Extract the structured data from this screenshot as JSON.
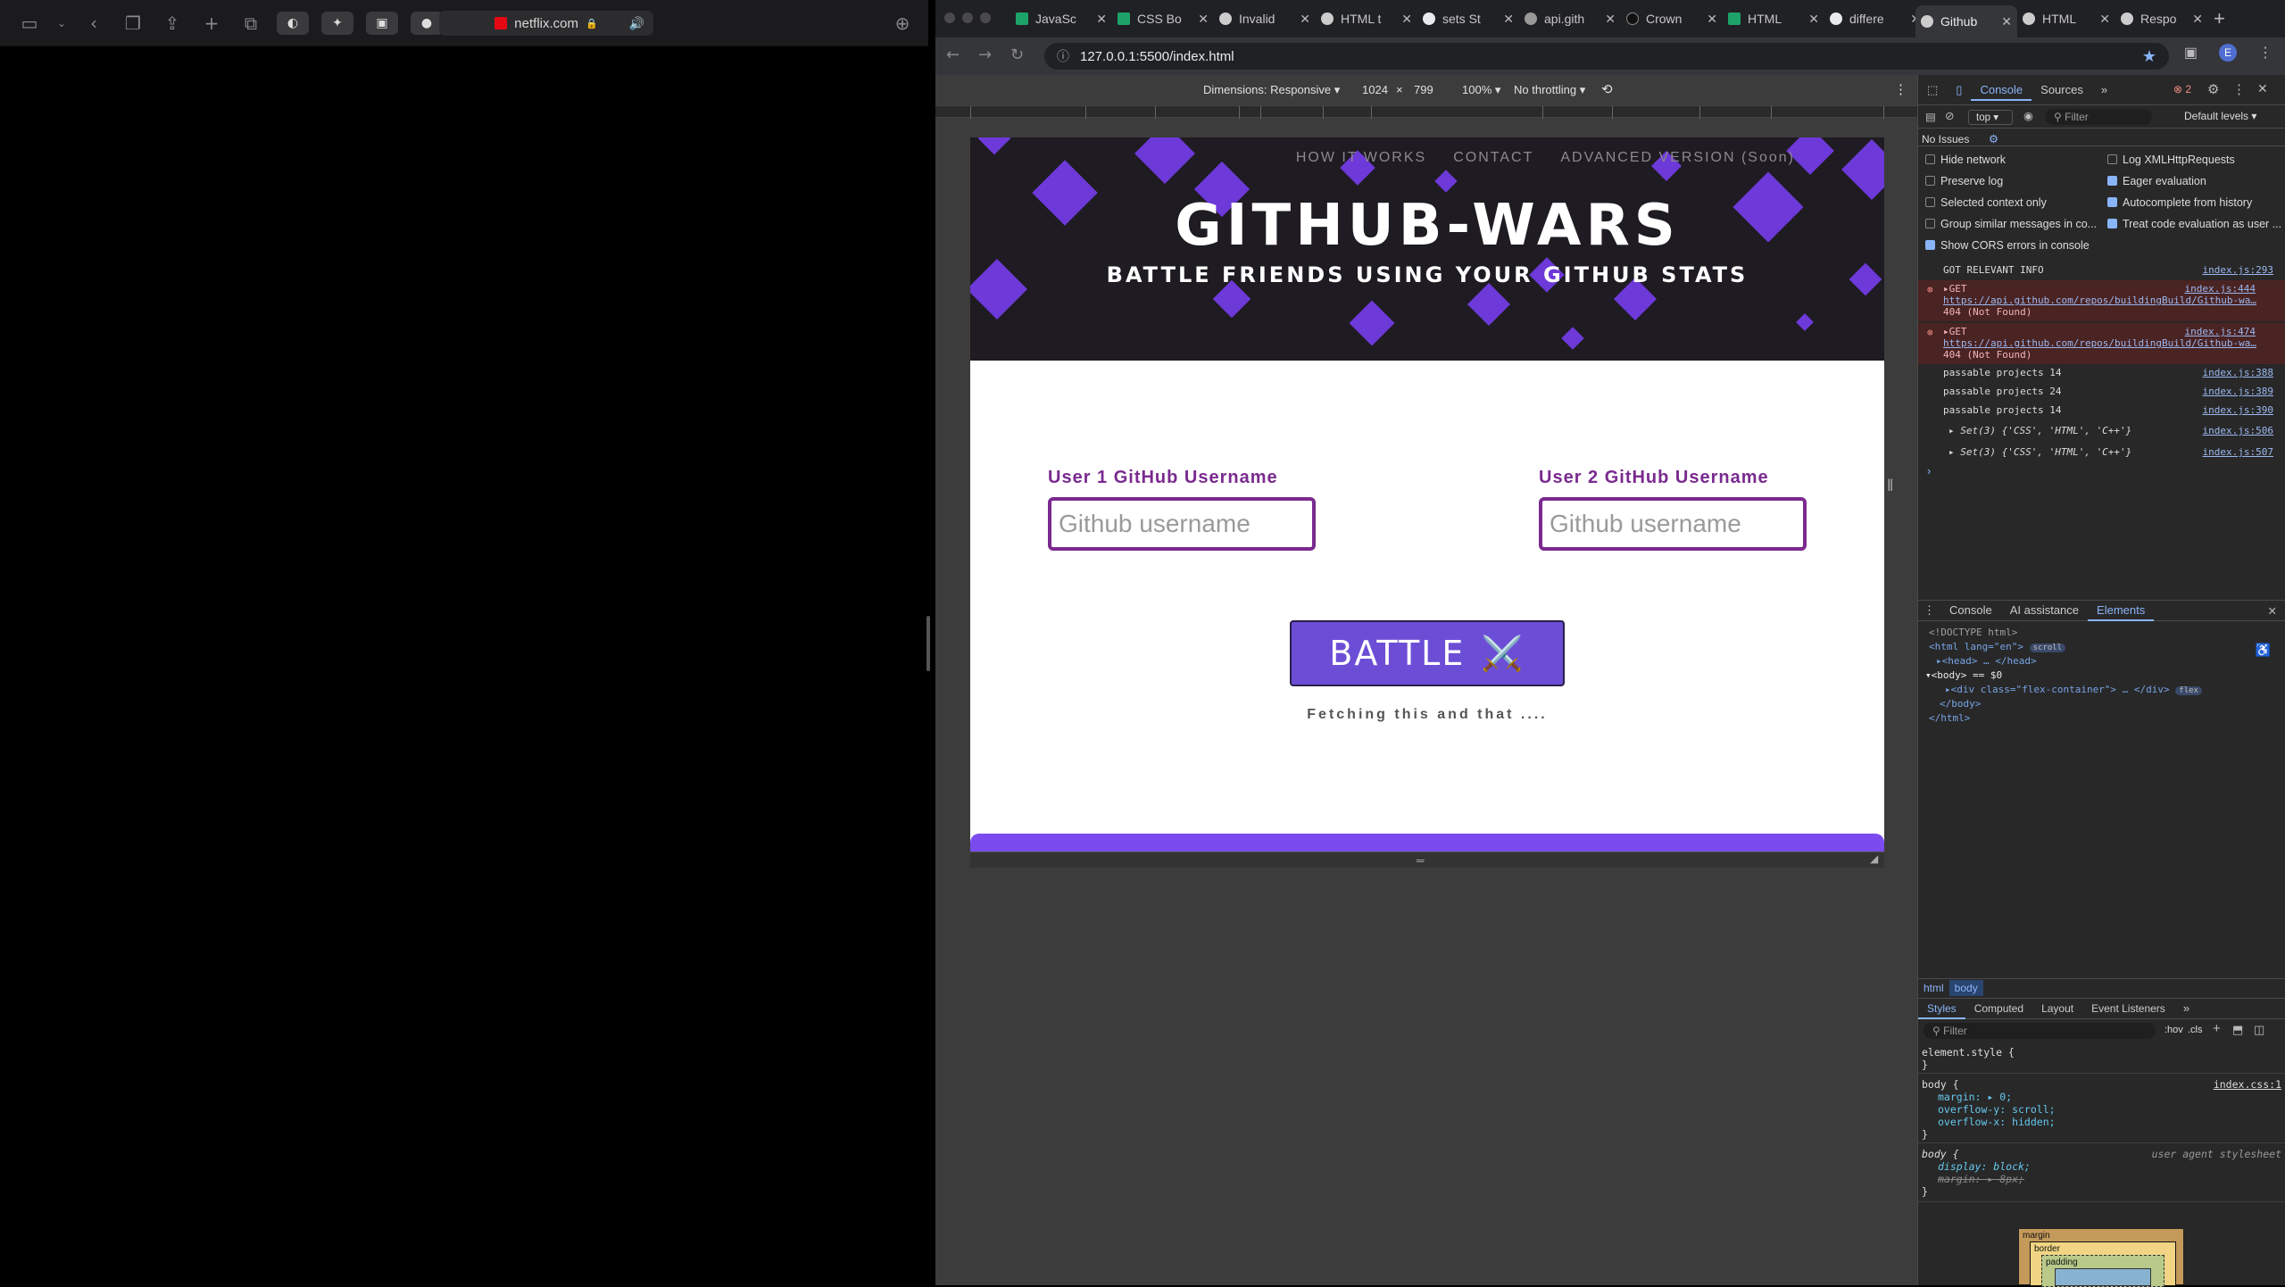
{
  "safari": {
    "url": "netflix.com"
  },
  "chrome": {
    "tabs": [
      {
        "label": "JavaSc"
      },
      {
        "label": "CSS Bo"
      },
      {
        "label": "Invalid"
      },
      {
        "label": "HTML t"
      },
      {
        "label": "sets St"
      },
      {
        "label": "api.gith"
      },
      {
        "label": "Crown"
      },
      {
        "label": "HTML"
      },
      {
        "label": "differe"
      },
      {
        "label": "Github"
      },
      {
        "label": "HTML"
      },
      {
        "label": "Respo"
      }
    ],
    "url": "127.0.0.1:5500/index.html",
    "avatar_letter": "E"
  },
  "device_toolbar": {
    "dimensions": "Dimensions: Responsive",
    "width": "1024",
    "height": "799",
    "zoom": "100%",
    "throttling": "No throttling"
  },
  "page": {
    "nav": [
      "HOW IT WORKS",
      "CONTACT",
      "ADVANCED VERSION (Soon)"
    ],
    "title": "GITHUB-WARS",
    "subtitle": "BATTLE FRIENDS USING YOUR GITHUB STATS",
    "user1_label": "User 1 GitHub Username",
    "user2_label": "User 2 GitHub Username",
    "input_placeholder": "Github username",
    "battle_label": "BATTLE",
    "battle_emoji": "⚔️",
    "fetch_text": "Fetching this and that ...."
  },
  "devtools": {
    "top_tabs": [
      "Console",
      "Sources"
    ],
    "error_count": "2",
    "context": "top",
    "filter_placeholder": "Filter",
    "levels": "Default levels",
    "issues": "No Issues",
    "options_left": [
      "Hide network",
      "Preserve log",
      "Selected context only",
      "Group similar messages in co...",
      "Show CORS errors in console"
    ],
    "options_right": [
      "Log XMLHttpRequests",
      "Eager evaluation",
      "Autocomplete from history",
      "Treat code evaluation as user ..."
    ],
    "logs": [
      {
        "text": "GOT RELEVANT INFO",
        "src": "index.js:293",
        "type": "log"
      },
      {
        "text": "▸GET",
        "url": "https://api.github.com/repos/buildingBuild/Github-wa…",
        "status": "404 (Not Found)",
        "src": "index.js:444",
        "type": "err"
      },
      {
        "text": "▸GET",
        "url": "https://api.github.com/repos/buildingBuild/Github-wa…",
        "status": "404 (Not Found)",
        "src": "index.js:474",
        "type": "err"
      },
      {
        "text": "passable projects 14",
        "src": "index.js:388",
        "type": "log"
      },
      {
        "text": "passable projects 24",
        "src": "index.js:389",
        "type": "log"
      },
      {
        "text": "passable projects 14",
        "src": "index.js:390",
        "type": "log"
      },
      {
        "text": "▸ Set(3) {'CSS', 'HTML', 'C++'}",
        "src": "index.js:506",
        "type": "log"
      },
      {
        "text": "▸ Set(3) {'CSS', 'HTML', 'C++'}",
        "src": "index.js:507",
        "type": "log"
      }
    ],
    "drawer_tabs": [
      "Console",
      "AI assistance",
      "Elements"
    ],
    "elements": [
      "<!DOCTYPE html>",
      "<html lang=\"en\">",
      "▸<head> … </head>",
      "▾<body> == $0",
      "▸<div class=\"flex-container\"> … </div>",
      "</body>",
      "</html>"
    ],
    "elements_badges": [
      "scroll",
      "flex"
    ],
    "breadcrumbs": [
      "html",
      "body"
    ],
    "style_tabs": [
      "Styles",
      "Computed",
      "Layout",
      "Event Listeners"
    ],
    "styles_filter": "Filter",
    "hov": ":hov",
    "cls": ".cls",
    "css": {
      "element_style": "element.style {",
      "rule1_selector": "body {",
      "rule1_src": "index.css:1",
      "rule1_props": [
        "margin: ▸ 0;",
        "overflow-y: scroll;",
        "overflow-x: hidden;"
      ],
      "rule2_selector": "body {",
      "rule2_src": "user agent stylesheet",
      "rule2_props": [
        "display: block;",
        "margin: ▸ 8px;"
      ]
    },
    "box_model": [
      "margin",
      "border",
      "padding"
    ]
  }
}
